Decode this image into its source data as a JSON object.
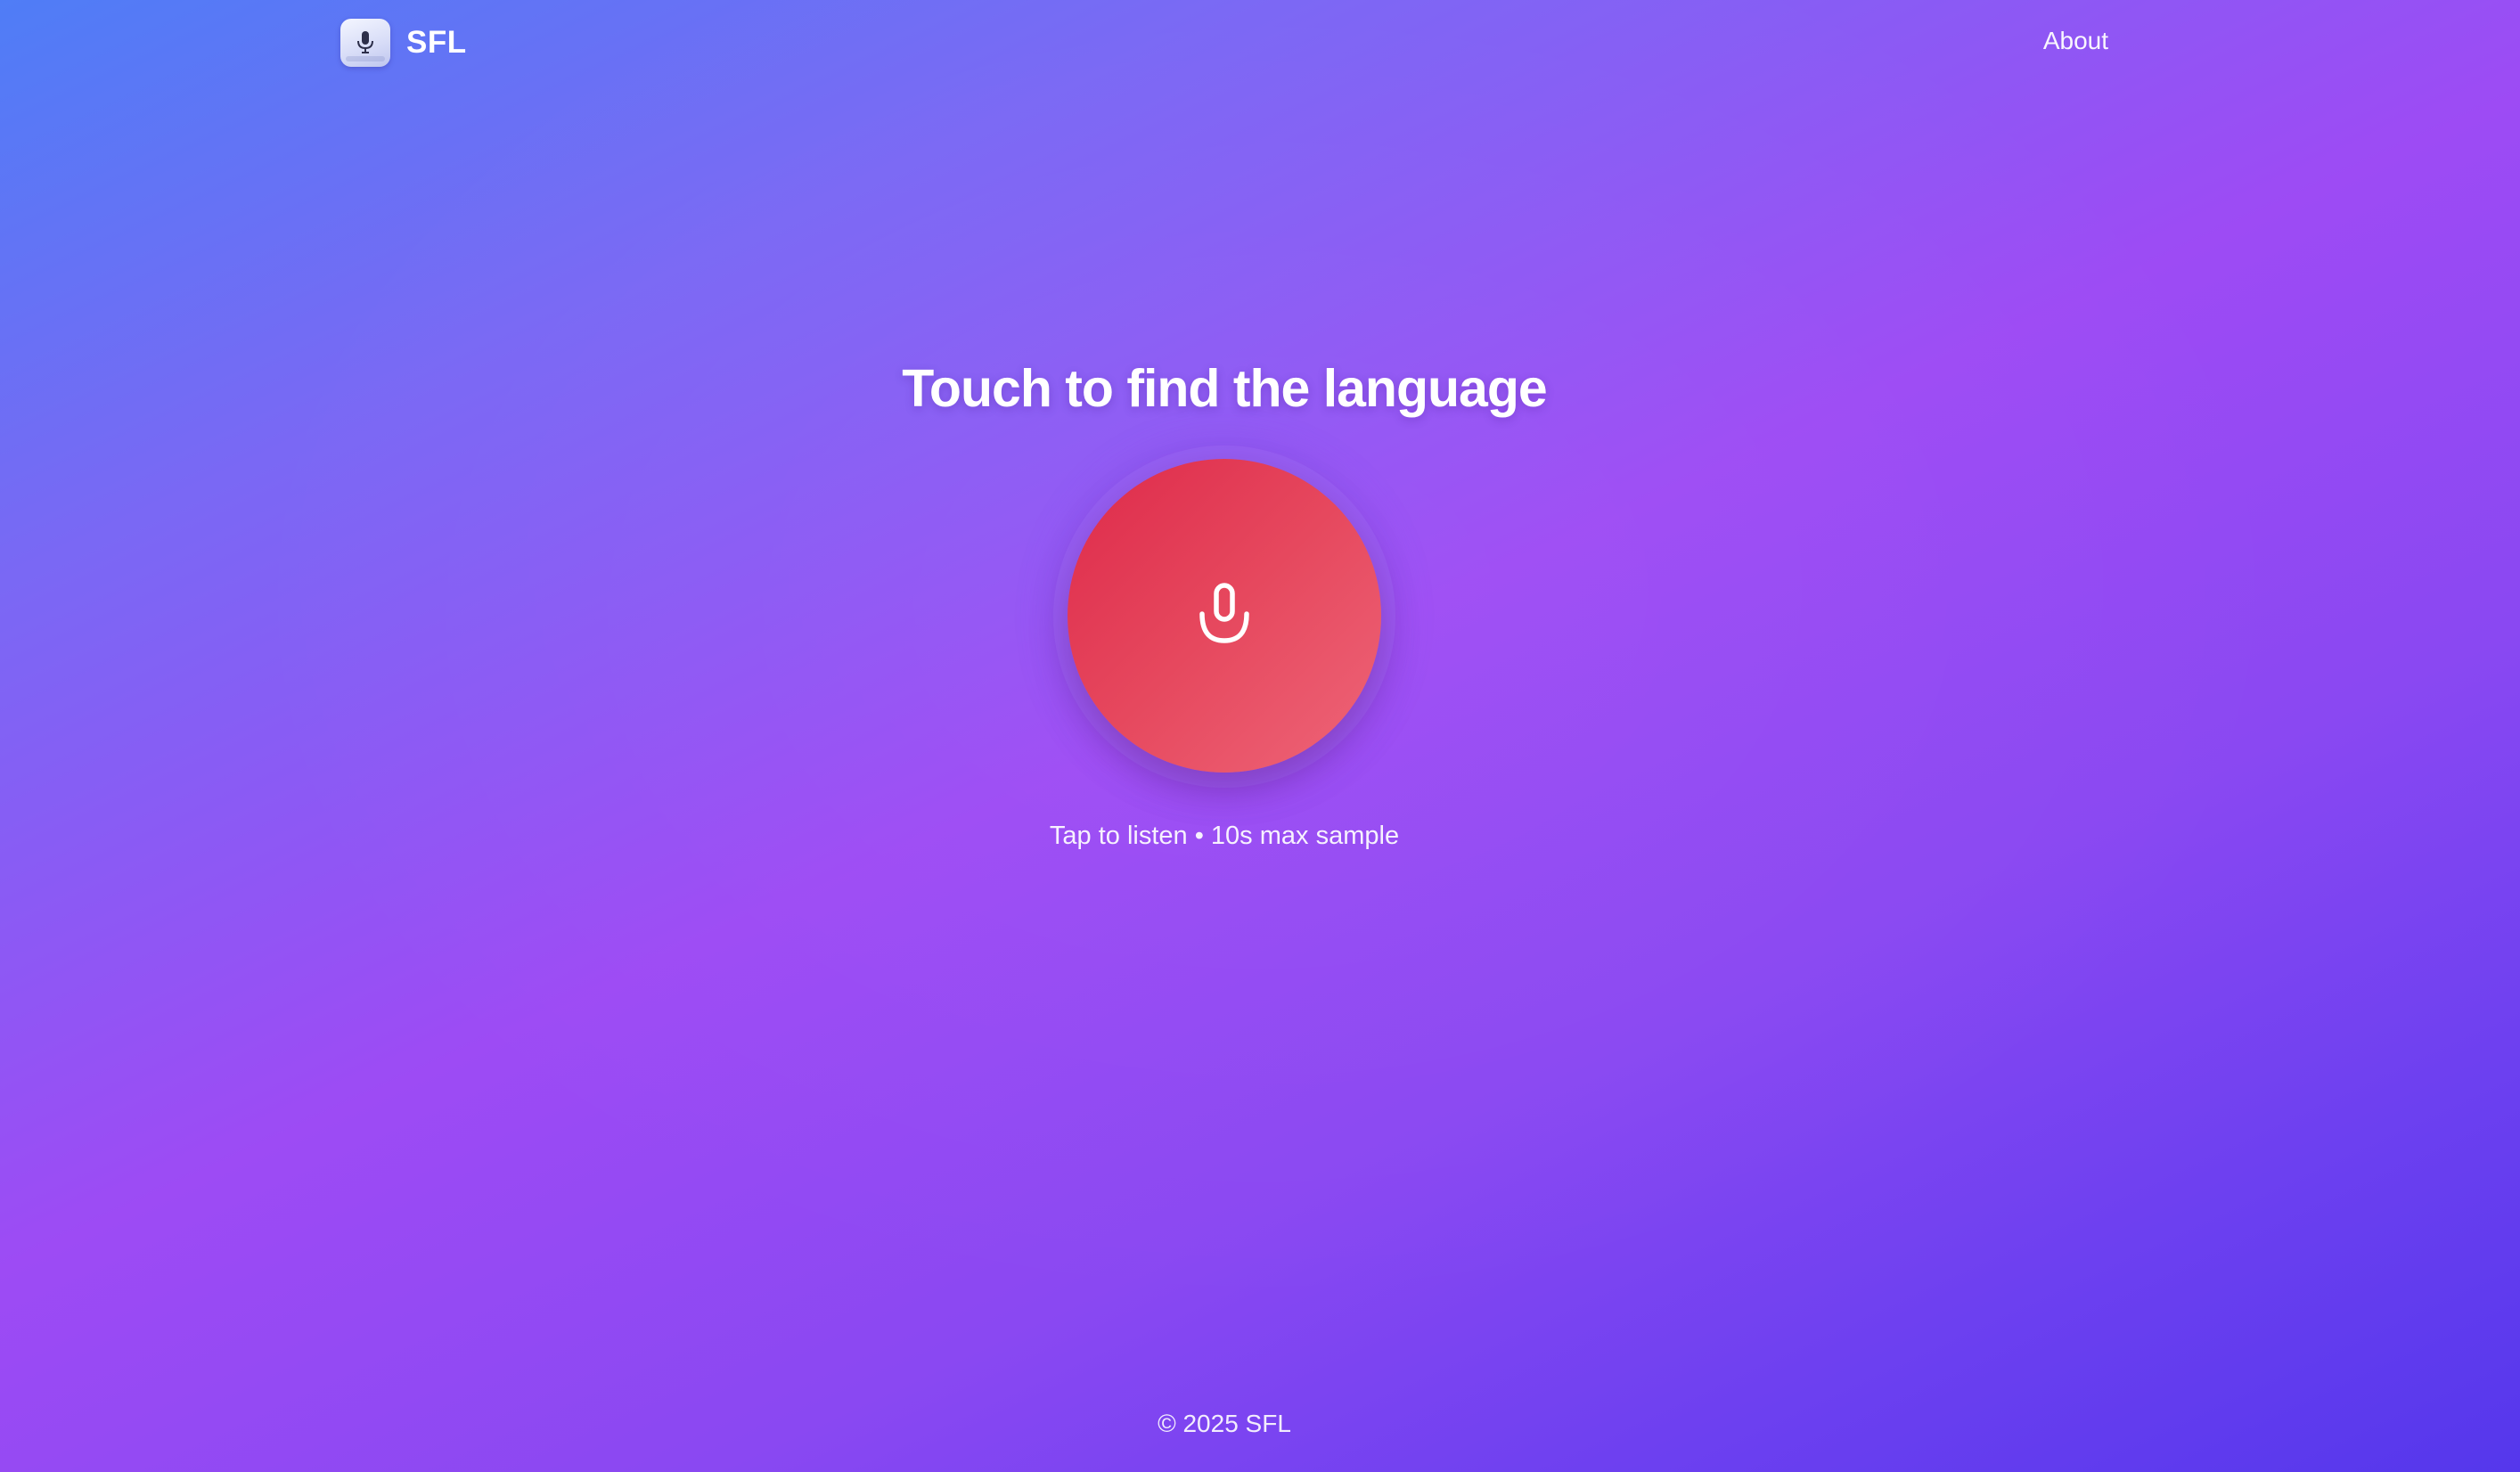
{
  "header": {
    "brand_name": "SFL",
    "logo_icon": "microphone-logo-icon",
    "nav": {
      "about_label": "About"
    }
  },
  "hero": {
    "headline": "Touch to find the language",
    "mic_button": {
      "icon": "microphone-icon",
      "color_start": "#de2a4a",
      "color_end": "#ee6578"
    },
    "caption": "Tap to listen • 10s max sample"
  },
  "footer": {
    "copyright": "© 2025 SFL"
  },
  "colors": {
    "background_start": "#4f7df6",
    "background_mid": "#9d4bf4",
    "background_end": "#5537ec",
    "text": "#ffffff"
  }
}
